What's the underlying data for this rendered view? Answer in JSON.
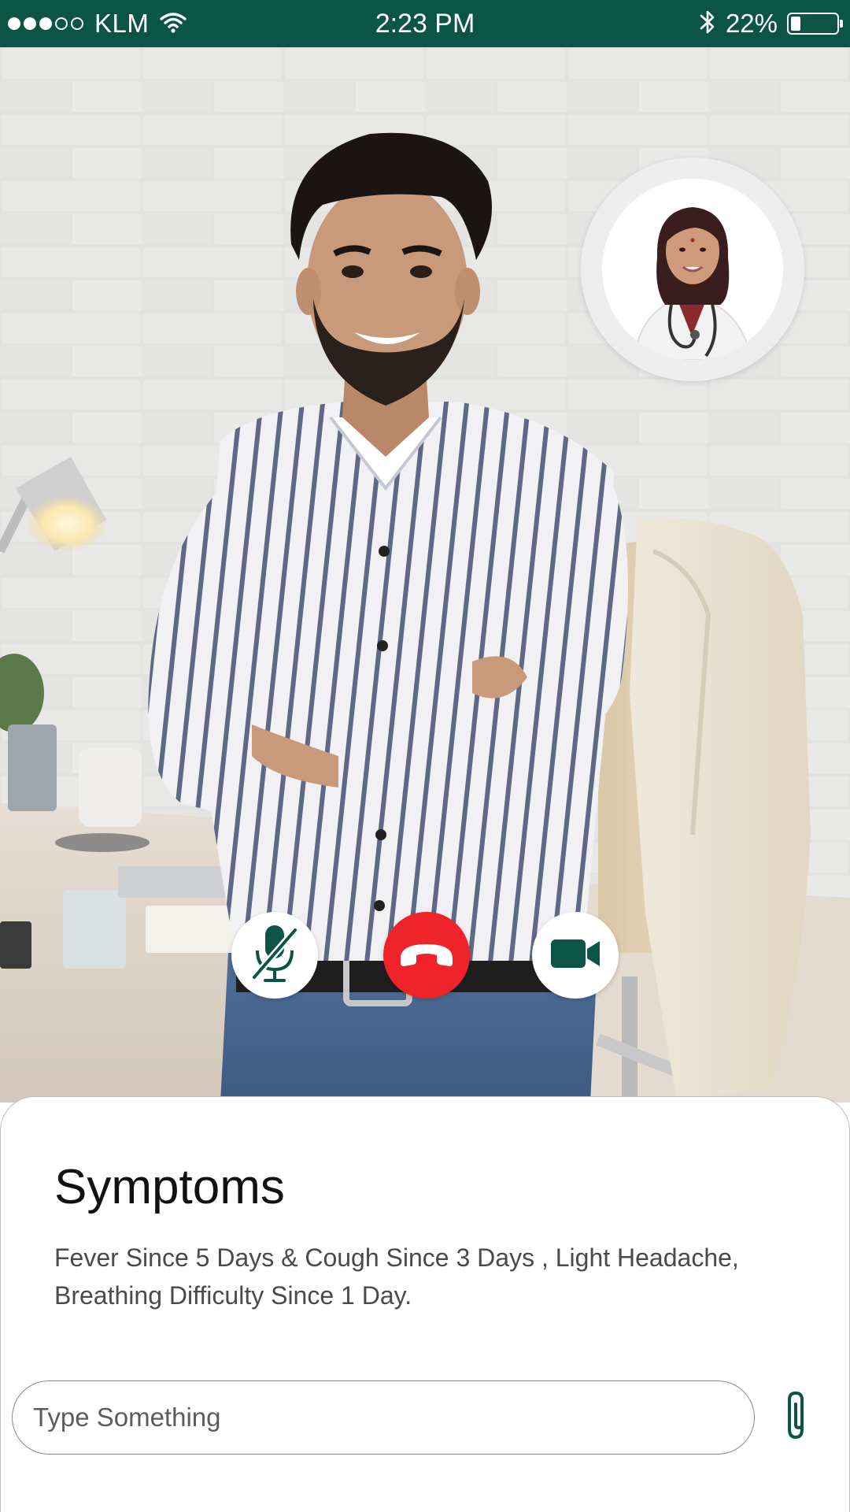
{
  "status_bar": {
    "signal_bars_filled": 3,
    "signal_bars_total": 5,
    "carrier": "KLM",
    "time": "2:23 PM",
    "battery_percent_label": "22%",
    "battery_level": 0.22,
    "icons": [
      "wifi-icon",
      "bluetooth-icon",
      "battery-icon"
    ]
  },
  "call": {
    "controls": [
      {
        "name": "mute-button",
        "icon": "microphone-muted-icon"
      },
      {
        "name": "end-call-button",
        "icon": "phone-hangup-icon"
      },
      {
        "name": "video-button",
        "icon": "video-camera-icon"
      }
    ]
  },
  "symptoms": {
    "title": "Symptoms",
    "description": "Fever Since 5 Days & Cough Since 3 Days , Light Headache, Breathing Difficulty Since 1 Day."
  },
  "composer": {
    "placeholder": "Type Something",
    "attach_icon": "paperclip-icon"
  },
  "colors": {
    "brand_green": "#0b5446",
    "end_call_red": "#f0232a",
    "panel_border": "#bfbfbf"
  }
}
